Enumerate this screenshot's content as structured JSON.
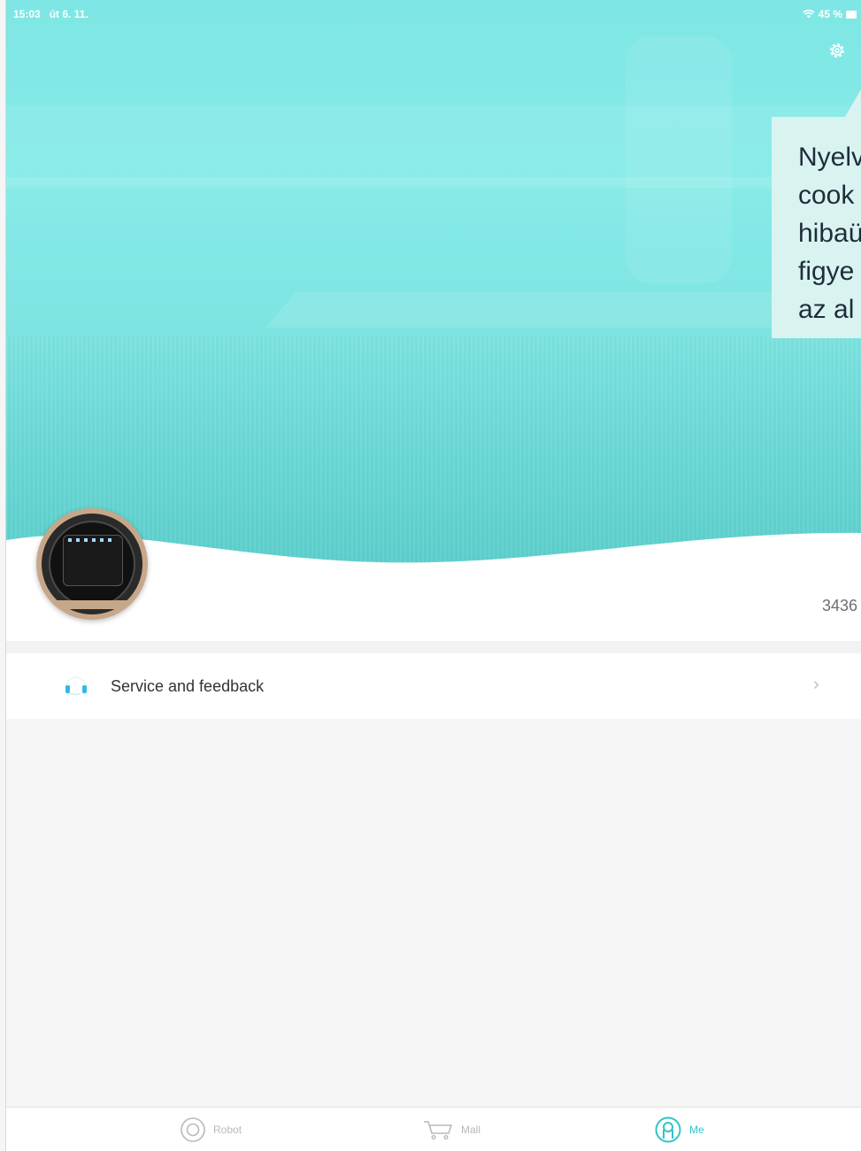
{
  "status_bar": {
    "time": "15:03",
    "date": "út 6. 11.",
    "battery_percent": "45 %",
    "wifi_icon": "wifi-icon",
    "battery_icon": "battery-icon"
  },
  "hero": {
    "settings_icon": "gear-icon",
    "accent_color": "#7ee6e4"
  },
  "tooltip": {
    "lines": [
      "Nyelv",
      "cook",
      "hibaü",
      "figye",
      "az al"
    ]
  },
  "profile": {
    "avatar_icon": "robot-vacuum-avatar",
    "device_id": "3436"
  },
  "menu": {
    "service_feedback": {
      "label": "Service and feedback",
      "icon": "headset-icon",
      "chevron": "›"
    }
  },
  "tabbar": {
    "items": [
      {
        "label": "Robot",
        "icon": "robot-icon",
        "active": false
      },
      {
        "label": "Mall",
        "icon": "cart-icon",
        "active": false
      },
      {
        "label": "Me",
        "icon": "me-icon",
        "active": true
      }
    ],
    "active_color": "#2fc4c8"
  }
}
